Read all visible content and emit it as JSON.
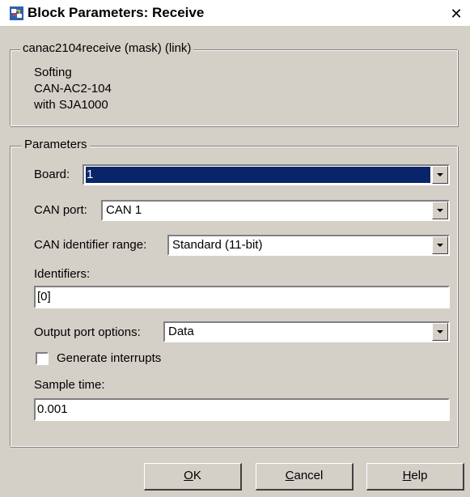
{
  "window": {
    "title": "Block Parameters: Receive",
    "close_glyph": "✕",
    "icon": "simulink-block-icon"
  },
  "mask": {
    "legend": "canac2104receive (mask) (link)",
    "description_lines": [
      "Softing",
      "CAN-AC2-104",
      "with SJA1000"
    ]
  },
  "parameters": {
    "legend": "Parameters",
    "board": {
      "label": "Board:",
      "value": "1"
    },
    "can_port": {
      "label": "CAN port:",
      "value": "CAN 1"
    },
    "id_range": {
      "label": "CAN identifier range:",
      "value": "Standard (11-bit)"
    },
    "identifiers": {
      "label": "Identifiers:",
      "value": "[0]"
    },
    "output_options": {
      "label": "Output port options:",
      "value": "Data"
    },
    "interrupts": {
      "label": "Generate interrupts",
      "checked": false
    },
    "sample_time": {
      "label": "Sample time:",
      "value": "0.001"
    }
  },
  "buttons": {
    "ok": {
      "accel": "O",
      "rest": "K"
    },
    "cancel": {
      "accel": "C",
      "rest": "ancel"
    },
    "help": {
      "accel": "H",
      "rest": "elp"
    }
  },
  "colors": {
    "face": "#d4d0c8",
    "selection": "#0a246a"
  }
}
